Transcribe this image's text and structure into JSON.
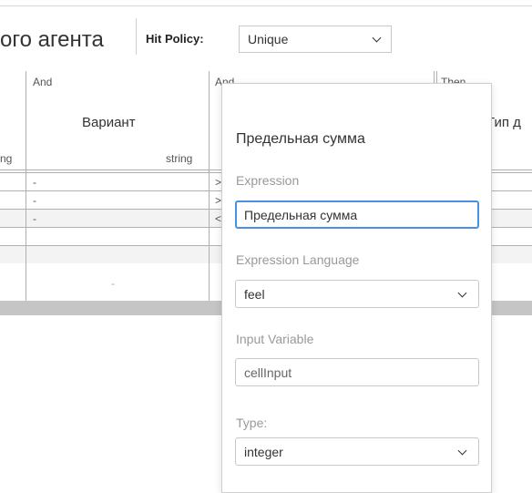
{
  "header": {
    "title": "ого агента",
    "hit_policy_label": "Hit Policy:",
    "hit_policy_value": "Unique"
  },
  "table": {
    "columns": [
      {
        "kind": "",
        "name": "",
        "type": "ng"
      },
      {
        "kind": "And",
        "name": "Вариант",
        "type": "string"
      },
      {
        "kind": "And",
        "name": "",
        "type": ""
      },
      {
        "kind": "Then",
        "name": "Тип д",
        "type": ""
      }
    ],
    "rows": [
      {
        "col1": "-",
        "col2": ">"
      },
      {
        "col1": "-",
        "col2": ">"
      },
      {
        "col1": "-",
        "col2": "<"
      },
      {
        "col1": "-",
        "col2": ""
      }
    ]
  },
  "popup": {
    "title": "Предельная сумма",
    "expression_label": "Expression",
    "expression_value": "Предельная сумма",
    "expression_language_label": "Expression Language",
    "expression_language_value": "feel",
    "input_variable_label": "Input Variable",
    "input_variable_value": "cellInput",
    "type_label": "Type:",
    "type_value": "integer"
  }
}
